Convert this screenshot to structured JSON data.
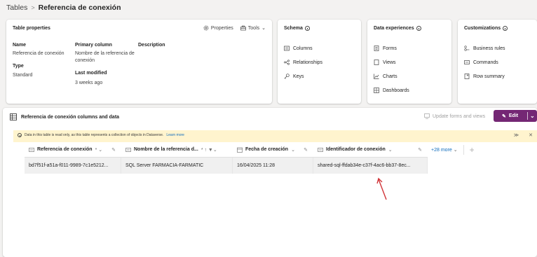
{
  "breadcrumb": {
    "root": "Tables",
    "separator": ">",
    "current": "Referencia de conexión"
  },
  "table_properties": {
    "title": "Table properties",
    "actions": {
      "properties": "Properties",
      "tools": "Tools"
    },
    "name_label": "Name",
    "name_value": "Referencia de conexión",
    "type_label": "Type",
    "type_value": "Standard",
    "primary_column_label": "Primary column",
    "primary_column_value": "Nombre de la referencia de conexión",
    "last_modified_label": "Last modified",
    "last_modified_value": "3 weeks ago",
    "description_label": "Description"
  },
  "schema": {
    "title": "Schema",
    "items": [
      "Columns",
      "Relationships",
      "Keys"
    ]
  },
  "data_experiences": {
    "title": "Data experiences",
    "items": [
      "Forms",
      "Views",
      "Charts",
      "Dashboards"
    ]
  },
  "customizations": {
    "title": "Customizations",
    "items": [
      "Business rules",
      "Commands",
      "Row summary"
    ]
  },
  "grid": {
    "title": "Referencia de conexión columns and data",
    "update_forms_label": "Update forms and views",
    "edit_label": "Edit",
    "banner_text": "Data in this table is read only, as this table represents a collection of objects in Dataverse.",
    "banner_link": "Learn more",
    "columns": [
      {
        "label": "Referencia de conexión",
        "suffix": "* ⌄"
      },
      {
        "label": "Nombre de la referencia d...",
        "suffix": "* ↑ ▼⌄"
      },
      {
        "label": "Fecha de creación",
        "suffix": "⌄"
      },
      {
        "label": "Identificador de conexión",
        "suffix": "⌄"
      }
    ],
    "rows": [
      [
        "bd7f51f-a51a-f011-9989-7c1e5212...",
        "SQL Server FARMACIA-FARMATIC",
        "16/04/2025 11:28",
        "shared-sql-ffdab34e-c37f-4ac6-bb37-8ec..."
      ]
    ],
    "more_columns": "+28 more",
    "add_column": "+"
  },
  "accent_color": "#742774",
  "annotation_color": "#d13438"
}
